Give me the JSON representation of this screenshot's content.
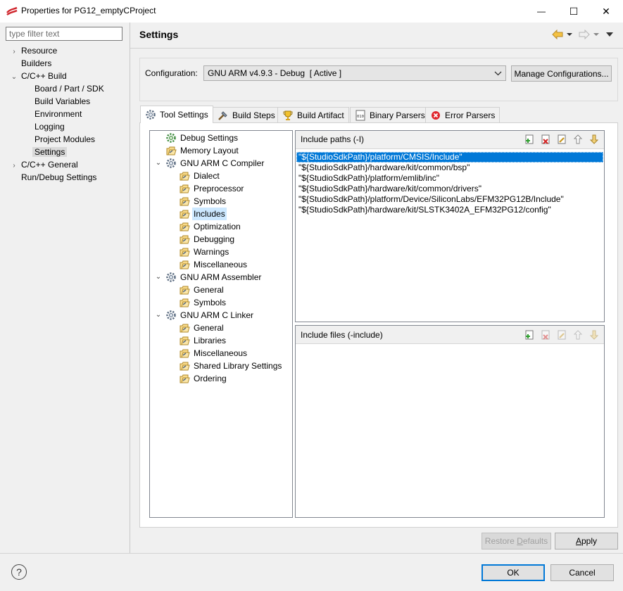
{
  "window": {
    "title": "Properties for PG12_emptyCProject",
    "minimize_glyph": "—",
    "maximize_glyph": "☐",
    "close_glyph": "✕"
  },
  "nav": {
    "filter_placeholder": "type filter text",
    "items": [
      {
        "label": "Resource",
        "depth": 0,
        "expander": "collapsed"
      },
      {
        "label": "Builders",
        "depth": 0,
        "expander": "none"
      },
      {
        "label": "C/C++ Build",
        "depth": 0,
        "expander": "expanded"
      },
      {
        "label": "Board / Part / SDK",
        "depth": 1,
        "expander": "none"
      },
      {
        "label": "Build Variables",
        "depth": 1,
        "expander": "none"
      },
      {
        "label": "Environment",
        "depth": 1,
        "expander": "none"
      },
      {
        "label": "Logging",
        "depth": 1,
        "expander": "none"
      },
      {
        "label": "Project Modules",
        "depth": 1,
        "expander": "none"
      },
      {
        "label": "Settings",
        "depth": 1,
        "expander": "none",
        "selected": true
      },
      {
        "label": "C/C++ General",
        "depth": 0,
        "expander": "collapsed"
      },
      {
        "label": "Run/Debug Settings",
        "depth": 0,
        "expander": "none"
      }
    ]
  },
  "header": {
    "title": "Settings",
    "back_icon": "back-arrow-icon",
    "forward_icon": "forward-arrow-icon",
    "menu_icon": "view-menu-icon"
  },
  "configuration": {
    "label": "Configuration:",
    "selected": "GNU ARM v4.9.3 - Debug  [ Active ]",
    "manage_button": "Manage Configurations..."
  },
  "tabs": [
    {
      "label": "Tool Settings",
      "icon": "tool-settings-icon",
      "active": true
    },
    {
      "label": "Build Steps",
      "icon": "build-steps-icon",
      "active": false
    },
    {
      "label": "Build Artifact",
      "icon": "trophy-icon",
      "active": false
    },
    {
      "label": "Binary Parsers",
      "icon": "binary-parser-icon",
      "active": false
    },
    {
      "label": "Error Parsers",
      "icon": "error-parser-icon",
      "active": false
    }
  ],
  "tool_tree": [
    {
      "label": "Debug Settings",
      "depth": 0,
      "expander": "none",
      "icon": "debug-gear-icon"
    },
    {
      "label": "Memory Layout",
      "depth": 0,
      "expander": "none",
      "icon": "option-page-icon"
    },
    {
      "label": "GNU ARM C Compiler",
      "depth": 0,
      "expander": "expanded",
      "icon": "tool-gear-icon"
    },
    {
      "label": "Dialect",
      "depth": 1,
      "expander": "none",
      "icon": "option-page-icon"
    },
    {
      "label": "Preprocessor",
      "depth": 1,
      "expander": "none",
      "icon": "option-page-icon"
    },
    {
      "label": "Symbols",
      "depth": 1,
      "expander": "none",
      "icon": "option-page-icon"
    },
    {
      "label": "Includes",
      "depth": 1,
      "expander": "none",
      "icon": "option-page-icon",
      "selected": true
    },
    {
      "label": "Optimization",
      "depth": 1,
      "expander": "none",
      "icon": "option-page-icon"
    },
    {
      "label": "Debugging",
      "depth": 1,
      "expander": "none",
      "icon": "option-page-icon"
    },
    {
      "label": "Warnings",
      "depth": 1,
      "expander": "none",
      "icon": "option-page-icon"
    },
    {
      "label": "Miscellaneous",
      "depth": 1,
      "expander": "none",
      "icon": "option-page-icon"
    },
    {
      "label": "GNU ARM Assembler",
      "depth": 0,
      "expander": "expanded",
      "icon": "tool-gear-icon"
    },
    {
      "label": "General",
      "depth": 1,
      "expander": "none",
      "icon": "option-page-icon"
    },
    {
      "label": "Symbols",
      "depth": 1,
      "expander": "none",
      "icon": "option-page-icon"
    },
    {
      "label": "GNU ARM C Linker",
      "depth": 0,
      "expander": "expanded",
      "icon": "tool-gear-icon"
    },
    {
      "label": "General",
      "depth": 1,
      "expander": "none",
      "icon": "option-page-icon"
    },
    {
      "label": "Libraries",
      "depth": 1,
      "expander": "none",
      "icon": "option-page-icon"
    },
    {
      "label": "Miscellaneous",
      "depth": 1,
      "expander": "none",
      "icon": "option-page-icon"
    },
    {
      "label": "Shared Library Settings",
      "depth": 1,
      "expander": "none",
      "icon": "option-page-icon"
    },
    {
      "label": "Ordering",
      "depth": 1,
      "expander": "none",
      "icon": "option-page-icon"
    }
  ],
  "include_paths": {
    "title": "Include paths (-I)",
    "toolbar": [
      "add-icon",
      "delete-icon",
      "edit-icon",
      "move-up-icon",
      "move-down-icon"
    ],
    "rows": [
      "\"${StudioSdkPath}/platform/CMSIS/Include\"",
      "\"${StudioSdkPath}/hardware/kit/common/bsp\"",
      "\"${StudioSdkPath}/platform/emlib/inc\"",
      "\"${StudioSdkPath}/hardware/kit/common/drivers\"",
      "\"${StudioSdkPath}/platform/Device/SiliconLabs/EFM32PG12B/Include\"",
      "\"${StudioSdkPath}/hardware/kit/SLSTK3402A_EFM32PG12/config\""
    ],
    "selected_index": 0
  },
  "include_files": {
    "title": "Include files (-include)",
    "toolbar": [
      "add-icon",
      "delete-icon",
      "edit-icon",
      "move-up-icon",
      "move-down-icon"
    ],
    "rows": []
  },
  "buttons": {
    "restore_defaults_pre": "Restore ",
    "restore_defaults_u": "D",
    "restore_defaults_post": "efaults",
    "apply_u": "A",
    "apply_post": "pply",
    "ok": "OK",
    "cancel": "Cancel",
    "help": "?"
  },
  "colors": {
    "selection": "#0078d7",
    "tree_selection": "#cce8ff",
    "nav_selection": "#d9d9d9"
  }
}
